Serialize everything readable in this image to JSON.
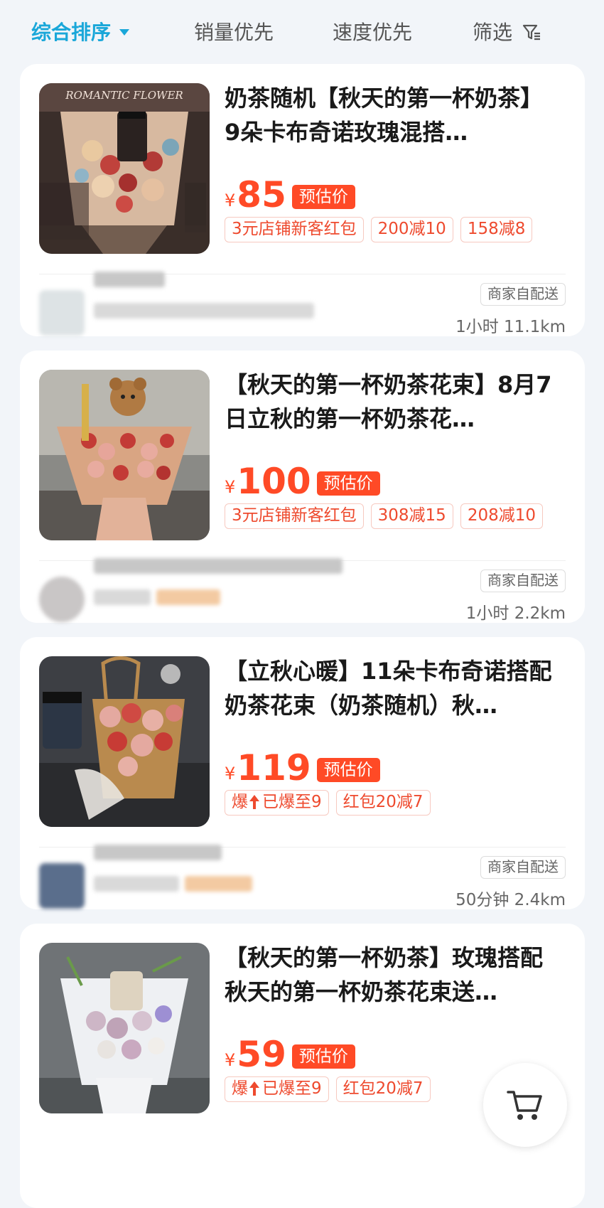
{
  "sort_bar": {
    "items": [
      {
        "label": "综合排序",
        "active": true
      },
      {
        "label": "销量优先",
        "active": false
      },
      {
        "label": "速度优先",
        "active": false
      },
      {
        "label": "筛选",
        "active": false
      }
    ]
  },
  "products": [
    {
      "title": "奶茶随机【秋天的第一杯奶茶】9朵卡布奇诺玫瑰混搭…",
      "yen": "¥",
      "price": "85",
      "price_badge": "预估价",
      "tags": [
        "3元店铺新客红包",
        "200减10",
        "158减8"
      ],
      "delivery": "商家自配送",
      "eta": "1小时 11.1km"
    },
    {
      "title": "【秋天的第一杯奶茶花束】8月7日立秋的第一杯奶茶花…",
      "yen": "¥",
      "price": "100",
      "price_badge": "预估价",
      "tags": [
        "3元店铺新客红包",
        "308减15",
        "208减10"
      ],
      "delivery": "商家自配送",
      "eta": "1小时 2.2km"
    },
    {
      "title": "【立秋心暖】11朵卡布奇诺搭配奶茶花束（奶茶随机）秋…",
      "yen": "¥",
      "price": "119",
      "price_badge": "预估价",
      "tags": [
        "已爆至9",
        "红包20减7"
      ],
      "delivery": "商家自配送",
      "eta": "50分钟 2.4km"
    },
    {
      "title": "【秋天的第一杯奶茶】玫瑰搭配秋天的第一杯奶茶花束送…",
      "yen": "¥",
      "price": "59",
      "price_badge": "预估价",
      "tags": [
        "已爆至9",
        "红包20减7"
      ]
    }
  ],
  "labels": {
    "hot_prefix": "爆"
  },
  "thumb_text": {
    "p1_banner": "ROMANTIC FLOWER"
  },
  "colors": {
    "accent_blue": "#1aa7d9",
    "price_red": "#ff4a26",
    "background": "#f2f5f9"
  },
  "icons": {
    "filter": "filter-icon",
    "cart": "cart-icon",
    "sort_caret": "caret-down-icon"
  }
}
